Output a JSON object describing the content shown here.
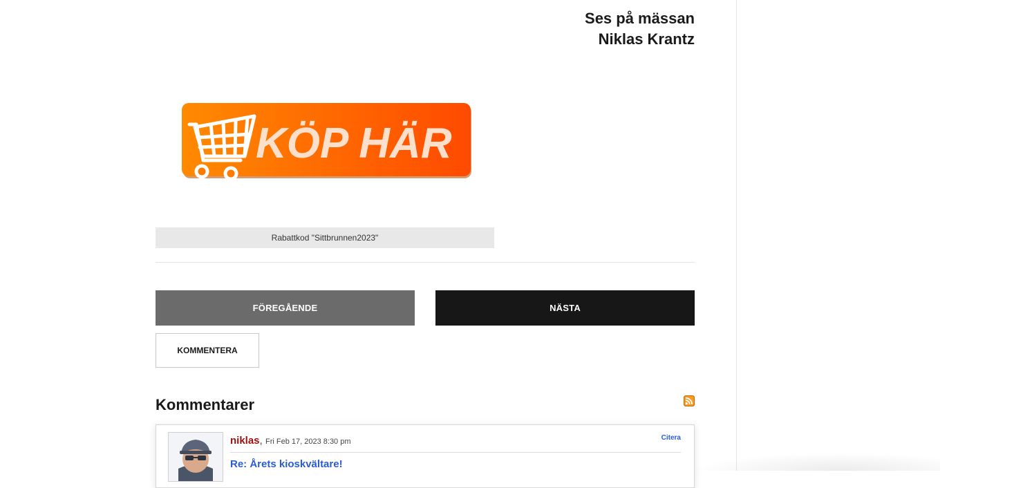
{
  "signature": {
    "line1": "Ses på mässan",
    "line2": "Niklas Krantz"
  },
  "buy_banner": {
    "text": "KÖP HÄR",
    "gradient_start": "#ff8a00",
    "gradient_end": "#ff4a00"
  },
  "promo": {
    "caption": "Rabattkod \"Sittbrunnen2023\""
  },
  "navigation": {
    "previous_label": "FÖREGÅENDE",
    "next_label": "NÄSTA",
    "comment_label": "KOMMENTERA"
  },
  "comments": {
    "heading": "Kommentarer",
    "items": [
      {
        "author": "niklas",
        "date": "Fri Feb 17, 2023 8:30 pm",
        "quote_label": "Citera",
        "title": "Re: Årets kioskvältare!"
      }
    ]
  },
  "colors": {
    "prev_button_bg": "#6b6b6b",
    "next_button_bg": "#171717",
    "author_color": "#a30f0f",
    "link_color": "#2a5bd7",
    "rss_orange": "#f79b22"
  }
}
